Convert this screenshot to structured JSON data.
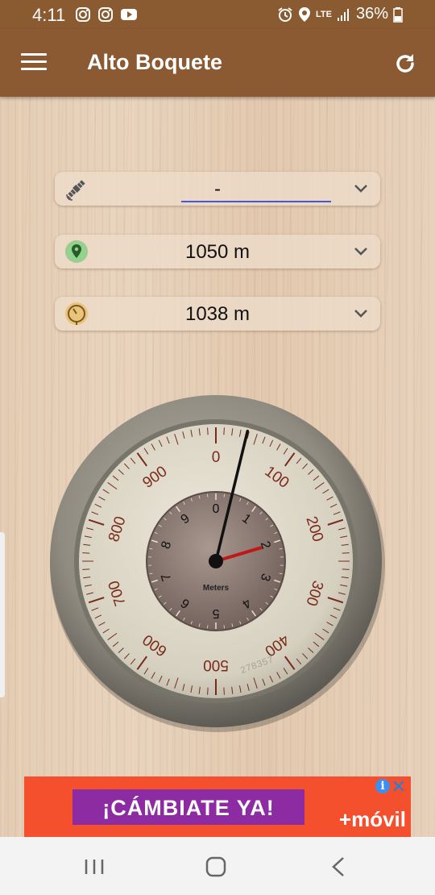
{
  "status": {
    "time": "4:11",
    "network": "LTE",
    "battery": "36%",
    "icons_left": [
      "instagram-icon",
      "instagram-icon",
      "youtube-icon"
    ],
    "icons_right": [
      "alarm-icon",
      "location-icon",
      "signal-icon",
      "battery-icon"
    ]
  },
  "appbar": {
    "title": "Alto Boquete",
    "color": "#8b5a32"
  },
  "fields": {
    "gps_altitude": "-",
    "map_altitude": "1050 m",
    "barometer_altitude": "1038 m"
  },
  "altimeter": {
    "unit_label": "Meters",
    "outer_ticks": [
      "0",
      "100",
      "200",
      "300",
      "400",
      "500",
      "600",
      "700",
      "800",
      "900"
    ],
    "inner_ticks": [
      "0",
      "1",
      "2",
      "3",
      "4",
      "5",
      "6",
      "7",
      "8",
      "9"
    ],
    "value_m": 1038,
    "serial": "278357"
  },
  "ad": {
    "headline": "¡CÁMBIATE YA!",
    "brand": "+móvil",
    "accent": "#f5502d",
    "box_color": "#8d2ba3"
  }
}
